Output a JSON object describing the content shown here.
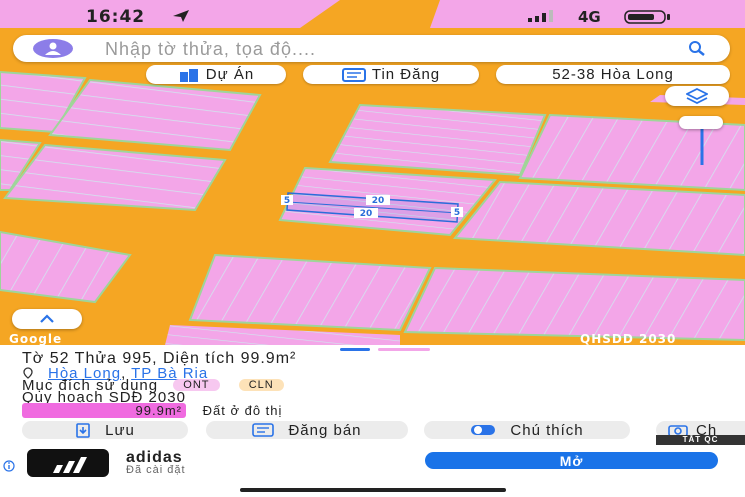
{
  "status_bar": {
    "time": "16:42",
    "network": "4G"
  },
  "search": {
    "placeholder": "Nhập tờ thửa, tọa độ...."
  },
  "chips": [
    {
      "label": "Dự Án",
      "icon": "building-icon"
    },
    {
      "label": "Tin Đăng",
      "icon": "listing-icon"
    },
    {
      "label": "52-38 Hòa Long",
      "icon": ""
    }
  ],
  "map": {
    "google_label": "Google",
    "layer_label": "QHSDD 2030",
    "dimensions": {
      "top": "20",
      "bottom": "20",
      "left": "5",
      "right": "5"
    },
    "colors": {
      "road": "#f5a623",
      "residential": "#f3a6e8",
      "parcel_line": "#cfe8ef"
    }
  },
  "info": {
    "title": "Tờ 52 Thửa 995, Diện tích 99.9m²",
    "ward": "Hòa Long",
    "separator": ",",
    "city": "TP Bà Rịa",
    "purpose_label": "Mục đích sử dụng",
    "tag_ont": "ONT",
    "tag_cln": "CLN",
    "planning_label": "Quy hoạch SDĐ 2030",
    "planning_area": "99.9m²",
    "planning_type": "Đất ở đô thị"
  },
  "actions": {
    "save": "Lưu",
    "post": "Đăng bán",
    "legend": "Chú thích",
    "share": "Ch"
  },
  "ad": {
    "badge": "TẮT QC",
    "name": "adidas",
    "status": "Đã cài đặt",
    "open": "Mở"
  }
}
